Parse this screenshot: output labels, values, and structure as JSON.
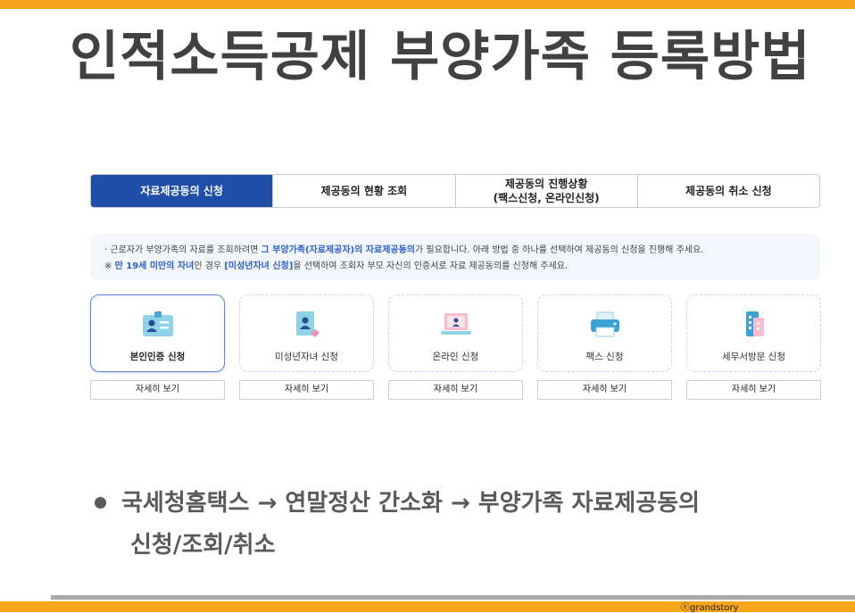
{
  "slide": {
    "title": "인적소득공제 부양가족 등록방법",
    "bullet_line1": "국세청홈택스 → 연말정산 간소화 → 부양가족 자료제공동의",
    "bullet_line2": "신청/조회/취소",
    "credit": "ⓒgrandstory"
  },
  "tabs": [
    {
      "label": "자료제공동의 신청",
      "active": true
    },
    {
      "label": "제공동의 현황 조회",
      "active": false
    },
    {
      "label": "제공동의 진행상황\n(팩스신청, 온라인신청)",
      "active": false
    },
    {
      "label": "제공동의 취소 신청",
      "active": false
    }
  ],
  "notice": {
    "line1_a": "· 근로자가 부양가족의 자료를 조회하려면 ",
    "line1_hl": "그 부양가족(자료제공자)의 자료제공동의",
    "line1_b": "가 필요합니다. 아래 방법 중 하나를 선택하여 제공동의 신청을 진행해 주세요.",
    "line2_a": "※ ",
    "line2_hl1": "만 19세 미만의 자녀",
    "line2_b": "인 경우 ",
    "line2_hl2": "[미성년자녀 신청]",
    "line2_c": "을 선택하여 조회자 부모 자신의 인증서로 자료 제공동의를 신청해 주세요."
  },
  "methods": [
    {
      "label": "본인인증 신청",
      "icon": "id-card-icon",
      "selected": true,
      "detail": "자세히 보기"
    },
    {
      "label": "미성년자녀 신청",
      "icon": "child-document-icon",
      "selected": false,
      "detail": "자세히 보기"
    },
    {
      "label": "온라인 신청",
      "icon": "laptop-icon",
      "selected": false,
      "detail": "자세히 보기"
    },
    {
      "label": "팩스 신청",
      "icon": "fax-printer-icon",
      "selected": false,
      "detail": "자세히 보기"
    },
    {
      "label": "세무서방문 신청",
      "icon": "tax-office-building-icon",
      "selected": false,
      "detail": "자세히 보기"
    }
  ],
  "colors": {
    "accent_orange": "#f7a61b",
    "tab_active": "#1f4fa8",
    "highlight_blue": "#2c5fd0"
  }
}
